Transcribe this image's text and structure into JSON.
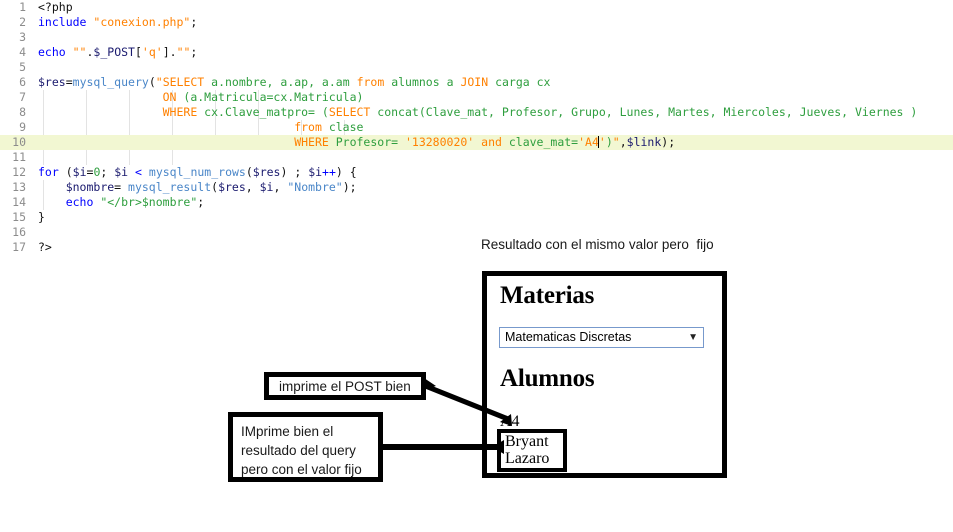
{
  "editor": {
    "lines": [
      {
        "n": "1",
        "highlighted": false,
        "tokens": [
          {
            "t": "<?php",
            "c": "tok-plain"
          }
        ]
      },
      {
        "n": "2",
        "highlighted": false,
        "tokens": [
          {
            "t": "include ",
            "c": "tok-kw"
          },
          {
            "t": "\"conexion.php\"",
            "c": "tok-str"
          },
          {
            "t": ";",
            "c": "tok-plain"
          }
        ]
      },
      {
        "n": "3",
        "highlighted": false,
        "tokens": []
      },
      {
        "n": "4",
        "highlighted": false,
        "tokens": [
          {
            "t": "echo ",
            "c": "tok-kw"
          },
          {
            "t": "\"\"",
            "c": "tok-str"
          },
          {
            "t": ".",
            "c": "tok-op"
          },
          {
            "t": "$_POST",
            "c": "tok-var"
          },
          {
            "t": "[",
            "c": "tok-op"
          },
          {
            "t": "'q'",
            "c": "tok-str"
          },
          {
            "t": "]",
            "c": "tok-op"
          },
          {
            "t": ".",
            "c": "tok-op"
          },
          {
            "t": "\"\"",
            "c": "tok-str"
          },
          {
            "t": ";",
            "c": "tok-plain"
          }
        ]
      },
      {
        "n": "5",
        "highlighted": false,
        "tokens": []
      },
      {
        "n": "6",
        "highlighted": false,
        "tokens": [
          {
            "t": "$res",
            "c": "tok-var"
          },
          {
            "t": "=",
            "c": "tok-op"
          },
          {
            "t": "mysql_query",
            "c": "tok-fn"
          },
          {
            "t": "(",
            "c": "tok-op"
          },
          {
            "t": "\"",
            "c": "tok-str"
          },
          {
            "t": "SELECT",
            "c": "tok-sql"
          },
          {
            "t": " a.nombre, a.ap, a.am ",
            "c": "tok-sqlid"
          },
          {
            "t": "from",
            "c": "tok-sql"
          },
          {
            "t": " alumnos a ",
            "c": "tok-sqlid"
          },
          {
            "t": "JOIN",
            "c": "tok-sql"
          },
          {
            "t": " carga cx",
            "c": "tok-sqlid"
          }
        ]
      },
      {
        "n": "7",
        "highlighted": false,
        "tokens": [
          {
            "t": "                  ",
            "c": "tok-plain"
          },
          {
            "t": "ON",
            "c": "tok-sql"
          },
          {
            "t": " (a.Matricula=cx.Matricula)",
            "c": "tok-sqlid"
          }
        ]
      },
      {
        "n": "8",
        "highlighted": false,
        "tokens": [
          {
            "t": "                  ",
            "c": "tok-plain"
          },
          {
            "t": "WHERE",
            "c": "tok-sql"
          },
          {
            "t": " cx.Clave_matpro= (",
            "c": "tok-sqlid"
          },
          {
            "t": "SELECT",
            "c": "tok-sql"
          },
          {
            "t": " concat(Clave_mat, Profesor, Grupo, Lunes, Martes, Miercoles, Jueves, Viernes )",
            "c": "tok-sqlid"
          }
        ]
      },
      {
        "n": "9",
        "highlighted": false,
        "tokens": [
          {
            "t": "                                     ",
            "c": "tok-plain"
          },
          {
            "t": "from",
            "c": "tok-sql"
          },
          {
            "t": " clase",
            "c": "tok-sqlid"
          }
        ]
      },
      {
        "n": "10",
        "highlighted": true,
        "tokens": [
          {
            "t": "                                     ",
            "c": "tok-plain"
          },
          {
            "t": "WHERE",
            "c": "tok-sql"
          },
          {
            "t": " Profesor= ",
            "c": "tok-sqlid"
          },
          {
            "t": "'13280020'",
            "c": "tok-str"
          },
          {
            "t": " and",
            "c": "tok-sql"
          },
          {
            "t": " clave_mat=",
            "c": "tok-sqlid"
          },
          {
            "t": "'A4",
            "c": "tok-str"
          },
          {
            "t": "|CARET|",
            "c": "caret"
          },
          {
            "t": "'",
            "c": "tok-str"
          },
          {
            "t": ")",
            "c": "tok-sqlid"
          },
          {
            "t": "\"",
            "c": "tok-str"
          },
          {
            "t": ",",
            "c": "tok-op"
          },
          {
            "t": "$link",
            "c": "tok-var"
          },
          {
            "t": ")",
            "c": "tok-op"
          },
          {
            "t": ";",
            "c": "tok-plain"
          }
        ]
      },
      {
        "n": "11",
        "highlighted": false,
        "tokens": []
      },
      {
        "n": "12",
        "highlighted": false,
        "tokens": [
          {
            "t": "for",
            "c": "tok-kw"
          },
          {
            "t": " (",
            "c": "tok-op"
          },
          {
            "t": "$i",
            "c": "tok-var"
          },
          {
            "t": "=",
            "c": "tok-op"
          },
          {
            "t": "0",
            "c": "tok-num"
          },
          {
            "t": "; ",
            "c": "tok-op"
          },
          {
            "t": "$i",
            "c": "tok-var"
          },
          {
            "t": " ",
            "c": "tok-op"
          },
          {
            "t": "<",
            "c": "tok-kw"
          },
          {
            "t": " ",
            "c": "tok-op"
          },
          {
            "t": "mysql_num_rows",
            "c": "tok-fn"
          },
          {
            "t": "(",
            "c": "tok-op"
          },
          {
            "t": "$res",
            "c": "tok-var"
          },
          {
            "t": ") ; ",
            "c": "tok-op"
          },
          {
            "t": "$i",
            "c": "tok-var"
          },
          {
            "t": "++",
            "c": "tok-kw"
          },
          {
            "t": ") {",
            "c": "tok-op"
          }
        ]
      },
      {
        "n": "13",
        "highlighted": false,
        "tokens": [
          {
            "t": "    ",
            "c": "tok-plain"
          },
          {
            "t": "$nombre",
            "c": "tok-var"
          },
          {
            "t": "= ",
            "c": "tok-op"
          },
          {
            "t": "mysql_result",
            "c": "tok-fn"
          },
          {
            "t": "(",
            "c": "tok-op"
          },
          {
            "t": "$res",
            "c": "tok-var"
          },
          {
            "t": ", ",
            "c": "tok-op"
          },
          {
            "t": "$i",
            "c": "tok-var"
          },
          {
            "t": ", ",
            "c": "tok-op"
          },
          {
            "t": "\"Nombre\"",
            "c": "tok-bstr"
          },
          {
            "t": ");",
            "c": "tok-op"
          }
        ]
      },
      {
        "n": "14",
        "highlighted": false,
        "tokens": [
          {
            "t": "    ",
            "c": "tok-plain"
          },
          {
            "t": "echo ",
            "c": "tok-kw"
          },
          {
            "t": "\"</br>$nombre\"",
            "c": "tok-sqlid"
          },
          {
            "t": ";",
            "c": "tok-plain"
          }
        ]
      },
      {
        "n": "15",
        "highlighted": false,
        "tokens": [
          {
            "t": "}",
            "c": "tok-plain"
          }
        ]
      },
      {
        "n": "16",
        "highlighted": false,
        "tokens": []
      },
      {
        "n": "17",
        "highlighted": false,
        "tokens": [
          {
            "t": "?>",
            "c": "tok-plain"
          }
        ]
      }
    ],
    "highlight_color": "#f2f7d2",
    "gutter_color": "#8c8c8c"
  },
  "annotations": {
    "result_note": "Resultado con el mismo valor pero  fijo",
    "callout_post": "imprime el POST bien",
    "callout_query_lines": [
      "IMprime bien el",
      "resultado del query",
      "pero con el valor fijo"
    ]
  },
  "output_panel": {
    "heading_materias": "Materias",
    "select_value": "Matematicas Discretas",
    "select_arrow": "▼",
    "heading_alumnos": "Alumnos",
    "alumno_code": "A4",
    "alumno_names": [
      "Bryant",
      "Lazaro"
    ],
    "border_color": "#000000",
    "select_border_color": "#7799cc"
  }
}
